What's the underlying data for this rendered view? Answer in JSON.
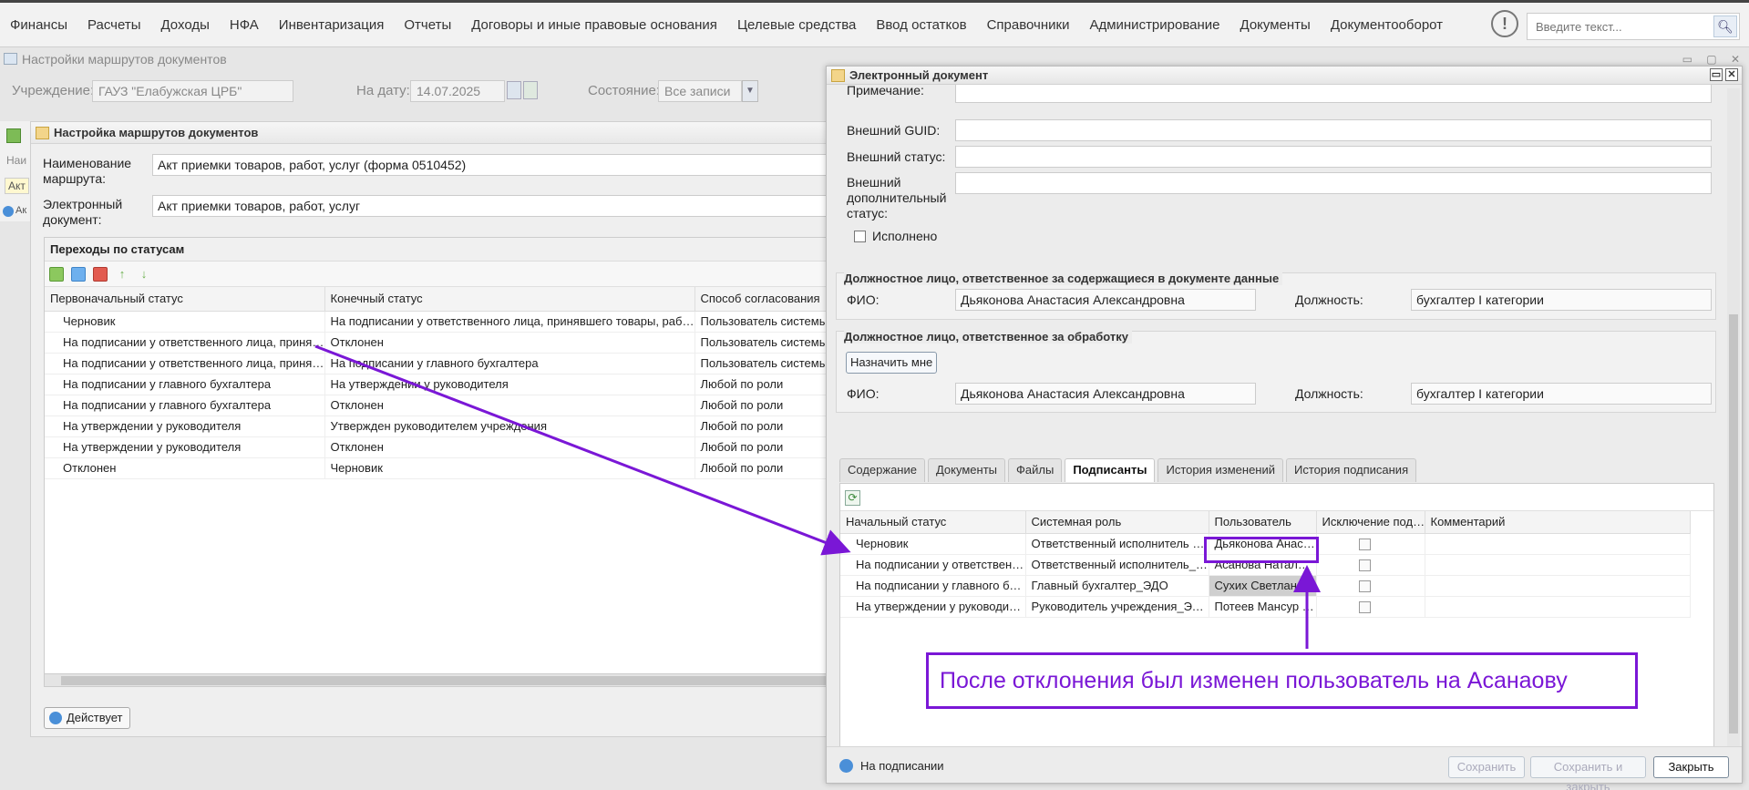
{
  "menu": [
    "Финансы",
    "Расчеты",
    "Доходы",
    "НФА",
    "Инвентаризация",
    "Отчеты",
    "Договоры и иные правовые основания",
    "Целевые средства",
    "Ввод остатков",
    "Справочники",
    "Администрирование",
    "Документы",
    "Документооборот"
  ],
  "search": {
    "placeholder": "Введите текст..."
  },
  "main_window": {
    "title": "Настройки маршрутов документов",
    "filters": {
      "institution_label": "Учреждение:",
      "institution_value": "ГАУЗ \"Елабужская ЦРБ\"",
      "date_label": "На дату:",
      "date_value": "14.07.2025",
      "state_label": "Состояние:",
      "state_value": "Все записи"
    },
    "behind": {
      "grid_header": "Наи",
      "row_value": "Акт",
      "row3": "Ак"
    }
  },
  "route_dialog": {
    "title": "Настройка маршрутов документов",
    "route_name_label": "Наименование маршрута:",
    "route_name_value": "Акт приемки товаров, работ, услуг (форма 0510452)",
    "edoc_label": "Электронный документ:",
    "edoc_value": "Акт приемки товаров, работ, услуг",
    "transitions_title": "Переходы по статусам",
    "columns": [
      "Первоначальный статус",
      "Конечный статус",
      "Способ согласования"
    ],
    "rows": [
      [
        "Черновик",
        "На подписании у ответственного лица, принявшего товары, работ…",
        "Пользователь системы"
      ],
      [
        "На подписании у ответственного лица, принявш…",
        "Отклонен",
        "Пользователь системы"
      ],
      [
        "На подписании у ответственного лица, принявш…",
        "На подписании у главного бухгалтера",
        "Пользователь системы"
      ],
      [
        "На подписании у главного бухгалтера",
        "На утверждении у руководителя",
        "Любой по роли"
      ],
      [
        "На подписании у главного бухгалтера",
        "Отклонен",
        "Любой по роли"
      ],
      [
        "На утверждении у руководителя",
        "Утвержден руководителем учреждения",
        "Любой по роли"
      ],
      [
        "На утверждении у руководителя",
        "Отклонен",
        "Любой по роли"
      ],
      [
        "Отклонен",
        "Черновик",
        "Любой по роли"
      ]
    ],
    "status_button": "Действует"
  },
  "edoc_dialog": {
    "title": "Электронный документ",
    "note_label": "Примечание:",
    "ext_guid_label": "Внешний GUID:",
    "ext_status_label": "Внешний статус:",
    "ext_add_status_label": "Внешний дополнительный статус:",
    "done_label": "Исполнено",
    "resp_data_title": "Должностное лицо, ответственное за содержащиеся в документе данные",
    "resp_proc_title": "Должностное лицо, ответственное за обработку",
    "fio_label": "ФИО:",
    "position_label": "Должность:",
    "fio_value": "Дьяконова Анастасия Александровна",
    "position_value": "бухгалтер I категории",
    "assign_me": "Назначить мне",
    "tabs": [
      "Содержание",
      "Документы",
      "Файлы",
      "Подписанты",
      "История изменений",
      "История подписания"
    ],
    "active_tab": "Подписанты",
    "signers_columns": [
      "Начальный статус",
      "Системная роль",
      "Пользователь",
      "Исключение под…",
      "Комментарий"
    ],
    "signers_rows": [
      [
        "Черновик",
        "Ответственный исполнитель б…",
        "Дьяконова Анас…"
      ],
      [
        "На подписании у ответственн…",
        "Ответственный исполнитель_Э…",
        "Асанова Натал…"
      ],
      [
        "На подписании у главного бу…",
        "Главный бухгалтер_ЭДО",
        "Сухих Светлана"
      ],
      [
        "На утверждении у руководит…",
        "Руководитель учреждения_ЭДО",
        "Потеев Мансур …"
      ]
    ],
    "footer_status": "На подписании",
    "save": "Сохранить",
    "save_close": "Сохранить и закрыть",
    "close": "Закрыть"
  },
  "annotation": "После отклонения был изменен пользователь на Асанаову",
  "colors": {
    "annotation": "#7a17d6"
  }
}
